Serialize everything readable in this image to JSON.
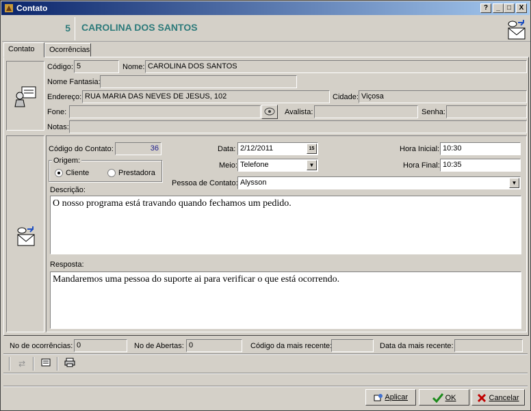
{
  "window": {
    "title": "Contato",
    "help_btn": "?",
    "min_btn": "_",
    "max_btn": "□",
    "close_btn": "X"
  },
  "header": {
    "number": "5",
    "name": "CAROLINA DOS SANTOS"
  },
  "tabs": [
    {
      "label": "Contato"
    },
    {
      "label": "Ocorrências"
    }
  ],
  "client": {
    "codigo_label": "Código:",
    "codigo": "5",
    "nome_label": "Nome:",
    "nome": "CAROLINA DOS SANTOS",
    "fantasia_label": "Nome Fantasia:",
    "fantasia": "",
    "endereco_label": "Endereço:",
    "endereco": "RUA MARIA DAS NEVES DE JESUS, 102",
    "cidade_label": "Cidade:",
    "cidade": "Viçosa",
    "fone_label": "Fone:",
    "fone": "",
    "avalista_label": "Avalista:",
    "avalista": "",
    "senha_label": "Senha:",
    "senha": "",
    "notas_label": "Notas:",
    "notas": ""
  },
  "contact": {
    "codigo_contato_label": "Código do Contato:",
    "codigo_contato": "36",
    "origem_label": "Origem:",
    "origem_cliente": "Cliente",
    "origem_prestadora": "Prestadora",
    "data_label": "Data:",
    "data": "2/12/2011",
    "calendar_badge": "15",
    "meio_label": "Meio:",
    "meio": "Telefone",
    "hora_inicial_label": "Hora Inicial:",
    "hora_inicial": "10:30",
    "hora_final_label": "Hora Final:",
    "hora_final": "10:35",
    "pessoa_label": "Pessoa de Contato:",
    "pessoa": "Alysson",
    "descricao_label": "Descrição:",
    "descricao": "O nosso programa está travando quando fechamos um pedido.",
    "resposta_label": "Resposta:",
    "resposta": "Mandaremos uma pessoa do suporte ai para verificar o que está ocorrendo."
  },
  "summary": {
    "ocorrencias_label": "No de ocorrências:",
    "ocorrencias": "0",
    "abertas_label": "No de Abertas:",
    "abertas": "0",
    "codigo_recente_label": "Código da mais recente:",
    "codigo_recente": "",
    "data_recente_label": "Data da mais recente:",
    "data_recente": ""
  },
  "buttons": {
    "aplicar": "Aplicar",
    "ok": "OK",
    "cancelar": "Cancelar"
  },
  "colors": {
    "accent_teal": "#2c7a7a",
    "title_bar": "#0a246a",
    "ok_check": "#1a8a1a",
    "cancel_x": "#c00000"
  }
}
